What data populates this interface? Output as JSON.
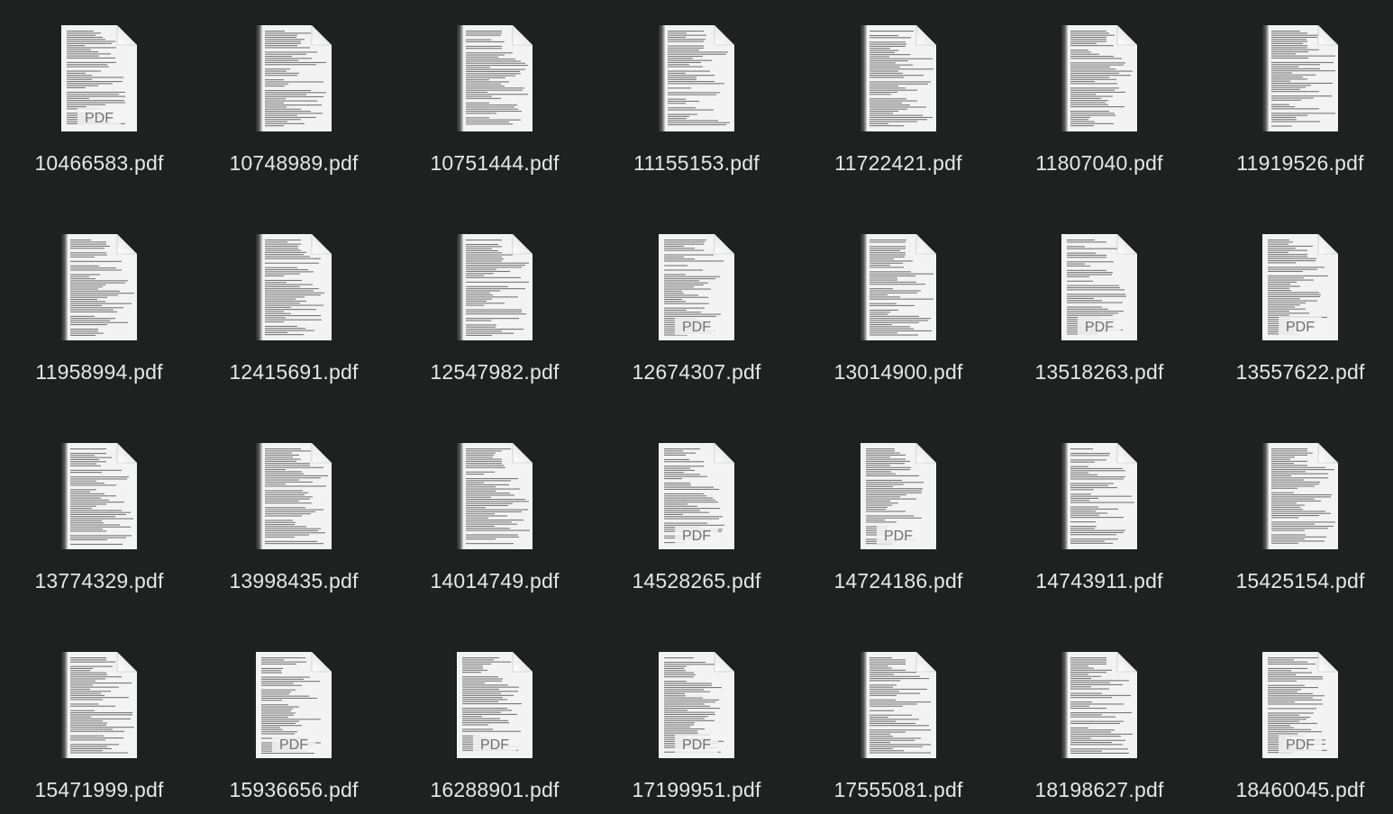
{
  "files": [
    {
      "name": "10466583.pdf",
      "style": "pdf-label"
    },
    {
      "name": "10748989.pdf",
      "style": "scanned"
    },
    {
      "name": "10751444.pdf",
      "style": "scanned"
    },
    {
      "name": "11155153.pdf",
      "style": "scanned"
    },
    {
      "name": "11722421.pdf",
      "style": "scanned"
    },
    {
      "name": "11807040.pdf",
      "style": "scanned"
    },
    {
      "name": "11919526.pdf",
      "style": "scanned"
    },
    {
      "name": "11958994.pdf",
      "style": "scanned"
    },
    {
      "name": "12415691.pdf",
      "style": "scanned"
    },
    {
      "name": "12547982.pdf",
      "style": "scanned"
    },
    {
      "name": "12674307.pdf",
      "style": "pdf-label"
    },
    {
      "name": "13014900.pdf",
      "style": "scanned"
    },
    {
      "name": "13518263.pdf",
      "style": "pdf-label"
    },
    {
      "name": "13557622.pdf",
      "style": "pdf-label"
    },
    {
      "name": "13774329.pdf",
      "style": "scanned"
    },
    {
      "name": "13998435.pdf",
      "style": "scanned"
    },
    {
      "name": "14014749.pdf",
      "style": "scanned"
    },
    {
      "name": "14528265.pdf",
      "style": "pdf-label"
    },
    {
      "name": "14724186.pdf",
      "style": "pdf-label"
    },
    {
      "name": "14743911.pdf",
      "style": "scanned"
    },
    {
      "name": "15425154.pdf",
      "style": "scanned"
    },
    {
      "name": "15471999.pdf",
      "style": "scanned"
    },
    {
      "name": "15936656.pdf",
      "style": "pdf-label"
    },
    {
      "name": "16288901.pdf",
      "style": "pdf-label"
    },
    {
      "name": "17199951.pdf",
      "style": "pdf-label"
    },
    {
      "name": "17555081.pdf",
      "style": "scanned"
    },
    {
      "name": "18198627.pdf",
      "style": "scanned"
    },
    {
      "name": "18460045.pdf",
      "style": "pdf-label"
    }
  ],
  "pdf_badge_text": "PDF",
  "colors": {
    "background": "#1f2020",
    "label": "#e6e6e6",
    "page": "#f4f4f4",
    "text_lines": "#6a6a6a",
    "scan_edge": "#2a2a2a"
  },
  "icons": {
    "file": "pdf-document-icon"
  }
}
